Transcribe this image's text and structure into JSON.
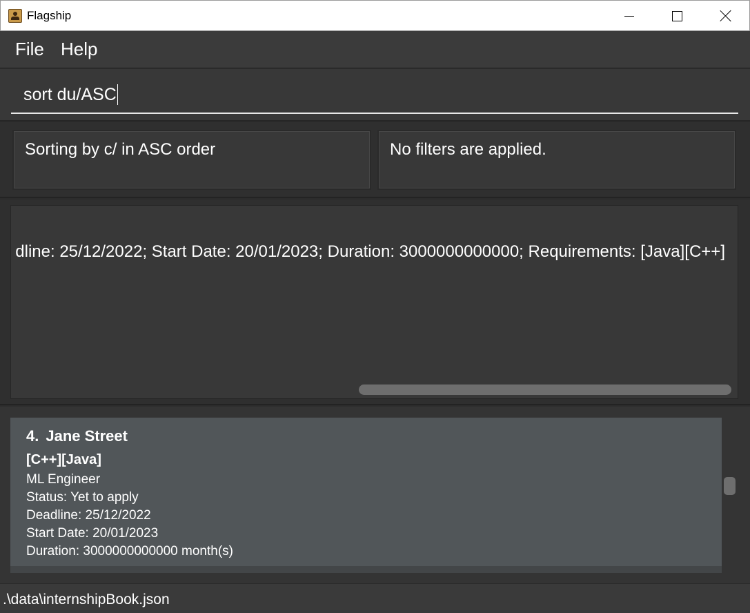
{
  "window": {
    "title": "Flagship"
  },
  "menu": {
    "items": [
      "File",
      "Help"
    ]
  },
  "command": {
    "value": "sort du/ASC"
  },
  "panels": {
    "sort_text": "Sorting by c/ in ASC order",
    "filter_text": "No filters are applied."
  },
  "result": {
    "text": "dline: 25/12/2022; Start Date: 20/01/2023; Duration: 3000000000000; Requirements: [Java][C++]"
  },
  "list": {
    "cards": [
      {
        "index": "4.",
        "company": "Jane Street",
        "tags": "[C++][Java]",
        "role": "ML Engineer",
        "status": "Status: Yet to apply",
        "deadline": "Deadline: 25/12/2022",
        "start_date": "Start Date: 20/01/2023",
        "duration": "Duration: 3000000000000 month(s)"
      }
    ]
  },
  "statusbar": {
    "path": ".\\data\\internshipBook.json"
  }
}
